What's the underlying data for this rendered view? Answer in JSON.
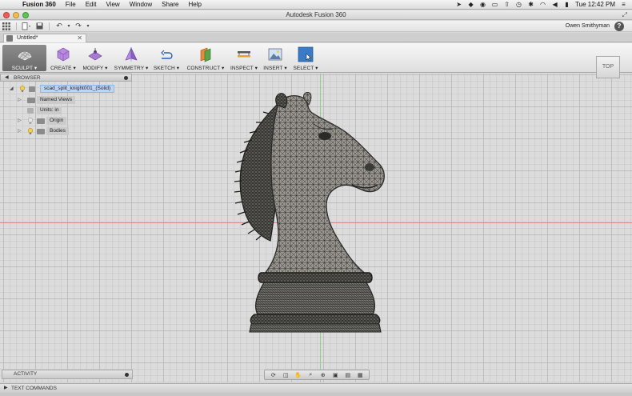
{
  "menubar": {
    "app_name": "Fusion 360",
    "items": [
      "File",
      "Edit",
      "View",
      "Window",
      "Share",
      "Help"
    ],
    "clock": "Tue 12:42 PM"
  },
  "window": {
    "title": "Autodesk Fusion 360"
  },
  "quick_access": {
    "user_name": "Owen Smithyman",
    "help_label": "?"
  },
  "document_tab": {
    "label": "Untitled*"
  },
  "ribbon": {
    "tools": [
      {
        "label": "SCULPT ▾",
        "icon": "sculpt-icon"
      },
      {
        "label": "CREATE ▾",
        "icon": "create-box-icon"
      },
      {
        "label": "MODIFY ▾",
        "icon": "modify-icon"
      },
      {
        "label": "SYMMETRY ▾",
        "icon": "symmetry-icon"
      },
      {
        "label": "SKETCH ▾",
        "icon": "sketch-icon"
      },
      {
        "label": "CONSTRUCT ▾",
        "icon": "construct-plane-icon"
      },
      {
        "label": "INSPECT ▾",
        "icon": "inspect-measure-icon"
      },
      {
        "label": "INSERT ▾",
        "icon": "insert-image-icon"
      },
      {
        "label": "SELECT ▾",
        "icon": "select-cursor-icon"
      }
    ]
  },
  "browser": {
    "header": "BROWSER",
    "root": "scad_split_knight001_(Solid)",
    "items": [
      {
        "label": "Named Views"
      },
      {
        "label": "Units: in"
      },
      {
        "label": "Origin"
      },
      {
        "label": "Bodies"
      }
    ]
  },
  "viewcube": {
    "face_label": "TOP"
  },
  "panels": {
    "activity": "ACTIVITY",
    "text_commands": "TEXT COMMANDS"
  },
  "colors": {
    "sculpt_active": "#7a7a7a",
    "selection_blue": "#b8d7f5",
    "axis_red": "#d98a8a",
    "axis_green": "#8ed08e",
    "mesh_dark": "#2b2b2b",
    "mesh_light": "#8f8e88"
  }
}
